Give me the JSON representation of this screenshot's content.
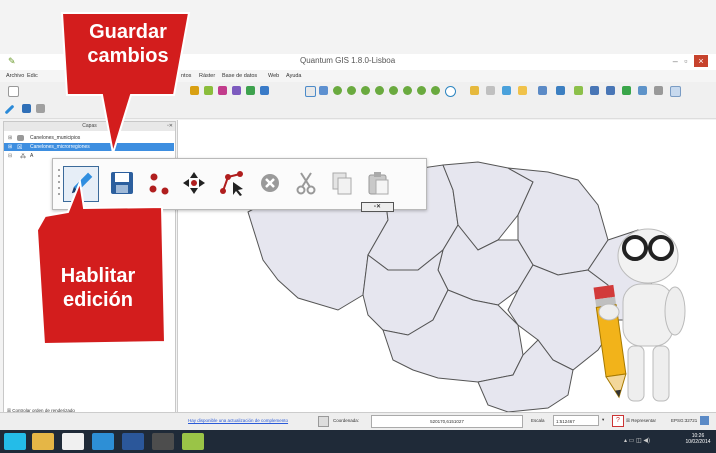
{
  "window": {
    "title": "Quantum GIS 1.8.0-Lisboa",
    "min_label": "–",
    "max_label": "▫",
    "close_label": "×"
  },
  "menu": [
    "Archivo",
    "Edic",
    "ntos",
    "Ráster",
    "Base de datos",
    "Web",
    "Ayuda"
  ],
  "layers_panel": {
    "title": "Capas",
    "layers": [
      {
        "name": "Canelones_municipios",
        "selected": false
      },
      {
        "name": "Canelones_microrregiones",
        "selected": true
      },
      {
        "name": "A",
        "selected": false
      }
    ],
    "footer_label": "Controlar orden de renderizado"
  },
  "edit_toolbar": {
    "icons": [
      "pencil-edit-icon",
      "save-icon",
      "add-point-icon",
      "move-feature-icon",
      "node-tool-icon",
      "delete-icon",
      "cut-icon",
      "copy-icon",
      "paste-icon"
    ]
  },
  "callouts": {
    "save": {
      "line1": "Guardar",
      "line2": "cambios"
    },
    "enable": {
      "line1": "Hablitar",
      "line2": "edición"
    }
  },
  "status": {
    "update_link": "Hay disponible una actualización de complemento",
    "coord_label": "Coordenada:",
    "coord_value": "520170,6151027",
    "scale_label": "Escala",
    "scale_value": "1:512467",
    "render_label": "Representar",
    "crs_label": "EPSG:32721"
  },
  "taskbar": {
    "clock_time": "10:26",
    "clock_date": "10/02/2014"
  },
  "colors": {
    "callout_red": "#d31d1d",
    "selection_blue": "#3d8ee0",
    "map_fill": "#e6e6ef",
    "map_stroke": "#555555"
  }
}
